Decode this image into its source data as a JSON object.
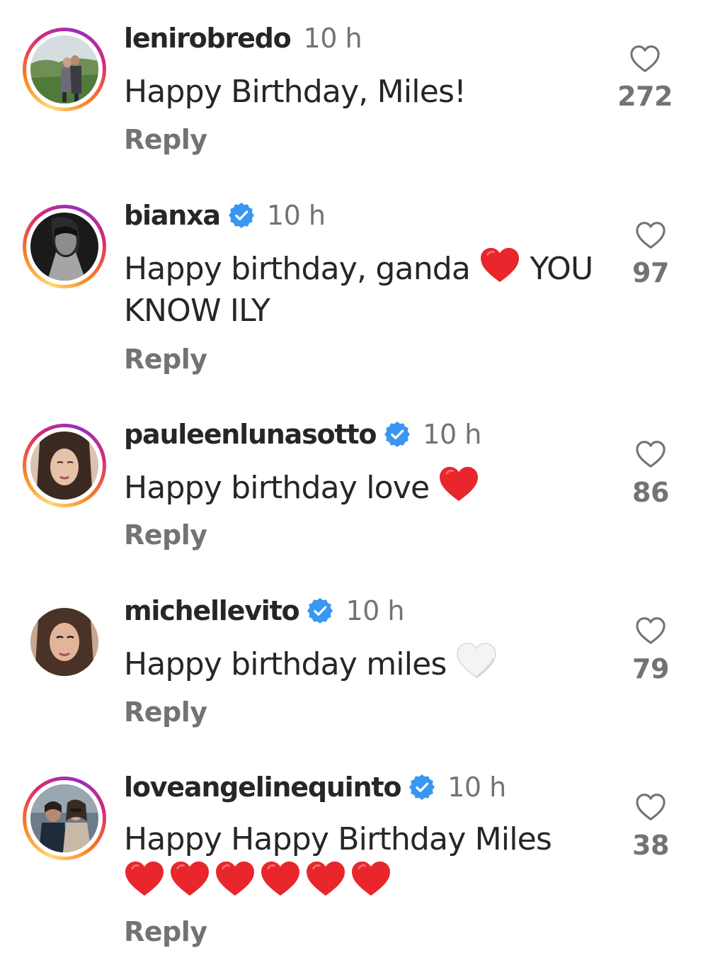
{
  "colors": {
    "verified_badge": "#3897f0",
    "heart_emoji": "#e8262c",
    "white_heart_emoji": "#f2f2f2",
    "muted_text": "#737373",
    "primary_text": "#262626"
  },
  "comments": [
    {
      "username": "lenirobredo",
      "verified": false,
      "time": "10 h",
      "text_lines": [
        "Happy Birthday, Miles!"
      ],
      "reply_label": "Reply",
      "like_icon": "heart-outline-icon",
      "likes": "272"
    },
    {
      "username": "bianxa",
      "verified": true,
      "time": "10 h",
      "text_lines": [
        "Happy birthday, ganda",
        "YOU",
        "KNOW ILY"
      ],
      "reply_label": "Reply",
      "like_icon": "heart-outline-icon",
      "likes": "97"
    },
    {
      "username": "pauleenlunasotto",
      "verified": true,
      "time": "10 h",
      "text_lines": [
        "Happy birthday love"
      ],
      "reply_label": "Reply",
      "like_icon": "heart-outline-icon",
      "likes": "86"
    },
    {
      "username": "michellevito",
      "verified": true,
      "time": "10 h",
      "text_lines": [
        "Happy birthday miles"
      ],
      "reply_label": "Reply",
      "like_icon": "heart-outline-icon",
      "likes": "79"
    },
    {
      "username": "loveangelinequinto",
      "verified": true,
      "time": "10 h",
      "text_lines": [
        "Happy Happy Birthday Miles"
      ],
      "reply_label": "Reply",
      "like_icon": "heart-outline-icon",
      "likes": "38"
    }
  ]
}
